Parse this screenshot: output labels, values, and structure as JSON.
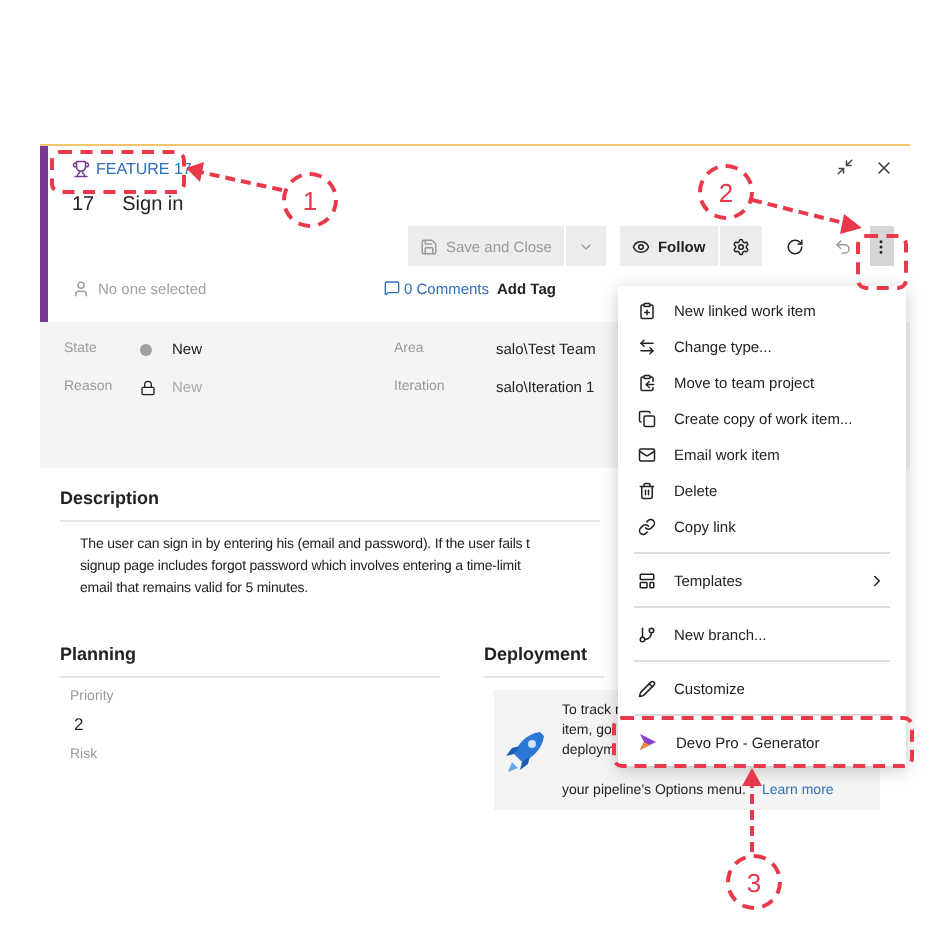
{
  "work_item": {
    "type_label": "FEATURE 17",
    "id": "17",
    "title": "Sign in",
    "toolbar": {
      "save": {
        "label": "Save and Close",
        "disabled": true
      },
      "follow": {
        "label": "Follow"
      },
      "more_expanded": true
    },
    "assigned": {
      "placeholder": "No one selected"
    },
    "comments": "0 Comments",
    "add_tag": "Add Tag",
    "fields": [
      {
        "label": "State",
        "value": "New",
        "kind": "state",
        "disabled": false
      },
      {
        "label": "Reason",
        "value": "New",
        "kind": "reason",
        "disabled": true
      }
    ],
    "classification": [
      {
        "label": "Area",
        "value": "salo\\Test Team"
      },
      {
        "label": "Iteration",
        "value": "salo\\Iteration 1"
      }
    ]
  },
  "description": {
    "heading": "Description",
    "lines": [
      "The user can sign in by entering his (email and password). If the user fails t",
      "signup page includes forgot password which involves entering a time-limit",
      "email that remains valid for 5 minutes."
    ]
  },
  "planning": {
    "heading": "Planning",
    "fields": [
      {
        "label": "Priority",
        "value": "2"
      },
      {
        "label": "Risk"
      }
    ]
  },
  "deployment": {
    "heading": "Deployment",
    "lines": [
      "To track r",
      "item, go",
      "deploym"
    ],
    "last_line": "your pipeline's Options menu.",
    "link": "Learn more"
  },
  "menu": {
    "groups": [
      [
        {
          "label": "New linked work item",
          "submenu": false
        },
        {
          "label": "Change type...",
          "submenu": false
        },
        {
          "label": "Move to team project",
          "submenu": false
        },
        {
          "label": "Create copy of work item...",
          "submenu": false
        },
        {
          "label": "Email work item",
          "submenu": false
        },
        {
          "label": "Delete",
          "submenu": false
        },
        {
          "label": "Copy link",
          "submenu": false
        }
      ],
      [
        {
          "label": "Templates",
          "submenu": true
        }
      ],
      [
        {
          "label": "New branch...",
          "submenu": false
        }
      ],
      [
        {
          "label": "Customize",
          "submenu": false
        }
      ],
      [
        {
          "label": "Devo Pro - Generator",
          "submenu": false
        }
      ]
    ]
  },
  "callouts": [
    {
      "number": "1"
    },
    {
      "number": "2"
    },
    {
      "number": "3"
    }
  ]
}
